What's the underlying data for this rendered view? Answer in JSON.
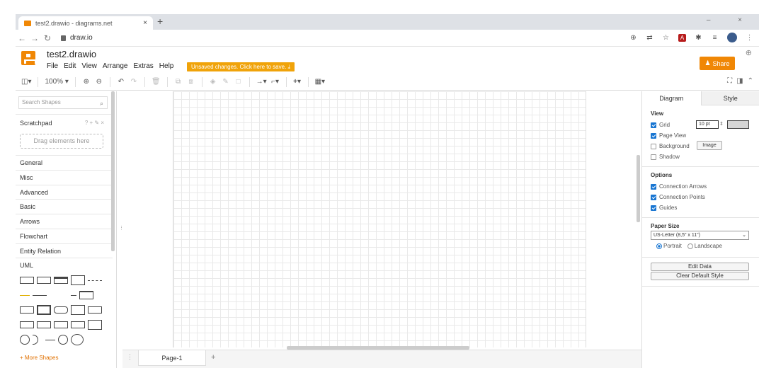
{
  "browser": {
    "tab_title": "test2.drawio - diagrams.net",
    "tab_close": "×",
    "new_tab": "+",
    "url": "draw.io",
    "window_controls": "–  ×"
  },
  "app": {
    "doc_title": "test2.drawio",
    "menu": [
      "File",
      "Edit",
      "View",
      "Arrange",
      "Extras",
      "Help"
    ],
    "unsaved_notice": "Unsaved changes. Click here to save. ⤓",
    "share_label": "Share"
  },
  "toolbar": {
    "zoom": "100%"
  },
  "left_panel": {
    "search_placeholder": "Search Shapes",
    "scratchpad_label": "Scratchpad",
    "scratchpad_tools": "? + ✎ ×",
    "drag_hint": "Drag elements here",
    "categories": [
      "General",
      "Misc",
      "Advanced",
      "Basic",
      "Arrows",
      "Flowchart",
      "Entity Relation",
      "UML"
    ],
    "more_shapes": "+ More Shapes"
  },
  "page_bar": {
    "page_tab": "Page-1",
    "add_page": "+"
  },
  "right_panel": {
    "tabs": [
      "Diagram",
      "Style"
    ],
    "view_title": "View",
    "grid_label": "Grid",
    "grid_size": "10 pt",
    "page_view_label": "Page View",
    "background_label": "Background",
    "image_button": "Image",
    "shadow_label": "Shadow",
    "options_title": "Options",
    "connection_arrows": "Connection Arrows",
    "connection_points": "Connection Points",
    "guides": "Guides",
    "paper_size_title": "Paper Size",
    "paper_size_value": "US-Letter (8,5\" x 11\")",
    "portrait": "Portrait",
    "landscape": "Landscape",
    "edit_data": "Edit Data",
    "clear_default_style": "Clear Default Style"
  },
  "colors": {
    "brand": "#f08705",
    "unsaved": "#f0a30a",
    "checkbox": "#1976d2"
  }
}
